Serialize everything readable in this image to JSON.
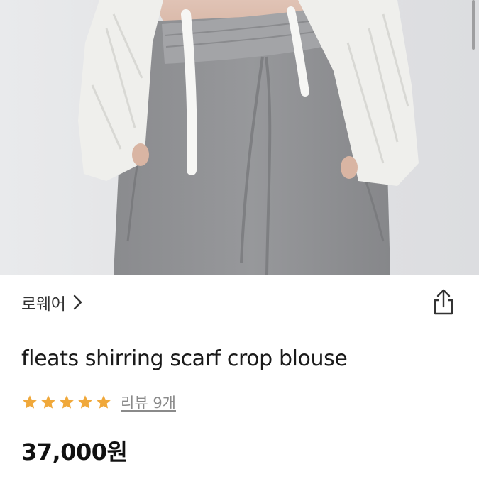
{
  "product_image": {
    "alt": "",
    "colors": {
      "background": "#e4e5e7",
      "pants": "#8f9093",
      "blouse": "#efefec"
    }
  },
  "brand": {
    "name": "로웨어",
    "icon": "chevron-right-icon"
  },
  "share": {
    "icon": "share-icon"
  },
  "product": {
    "title": "fleats shirring scarf crop blouse"
  },
  "rating": {
    "stars": 5,
    "max": 5,
    "star_color": "#f0a83a",
    "review_label": "리뷰 9개"
  },
  "price": {
    "amount": "37,000",
    "unit": "원"
  }
}
